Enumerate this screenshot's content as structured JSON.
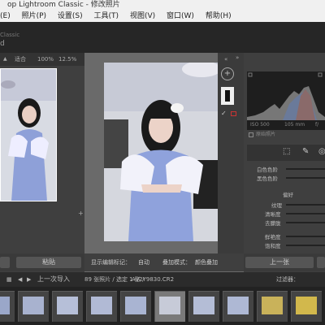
{
  "window": {
    "title": "op Lightroom Classic - 修改照片"
  },
  "menu": [
    "(E)",
    "照片(P)",
    "设置(S)",
    "工具(T)",
    "视图(V)",
    "窗口(W)",
    "帮助(H)"
  ],
  "identity": {
    "line1": "Classic",
    "line2": "d"
  },
  "navigator": {
    "fit": "适合",
    "p1": "100%",
    "p2": "12.5%"
  },
  "left_panel": {
    "paste_label": "粘贴"
  },
  "toolbar": {
    "show_edit_marks": "显示编辑标记：",
    "auto": "自动",
    "overlay_mode": "叠加模式：",
    "overlay_value": "颜色叠加"
  },
  "histogram": {
    "iso": "ISO 500",
    "focal": "105 mm",
    "aperture": "f/"
  },
  "original_photo_label": "原始照片",
  "sliders": {
    "whites": "白色色阶",
    "blacks": "黑色色阶",
    "presence": "偏好",
    "texture": "纹理",
    "clarity": "清晰度",
    "dehaze": "去朦胧",
    "vibrance": "鲜艳度",
    "saturation": "饱和度"
  },
  "right_panel": {
    "previous_label": "上一张"
  },
  "filmstrip": {
    "prev_import": "上一次导入",
    "count_info": "89 张照片 / 选定 1 张 /",
    "filename": "AV2Y9830.CR2",
    "filter_label": "过滤器："
  },
  "thumbs": [
    "",
    "",
    "",
    "",
    "",
    "",
    "",
    "",
    "",
    ""
  ],
  "colors": {
    "accent": "#b3b3b3",
    "selected_cell": "#7a7a7a"
  }
}
